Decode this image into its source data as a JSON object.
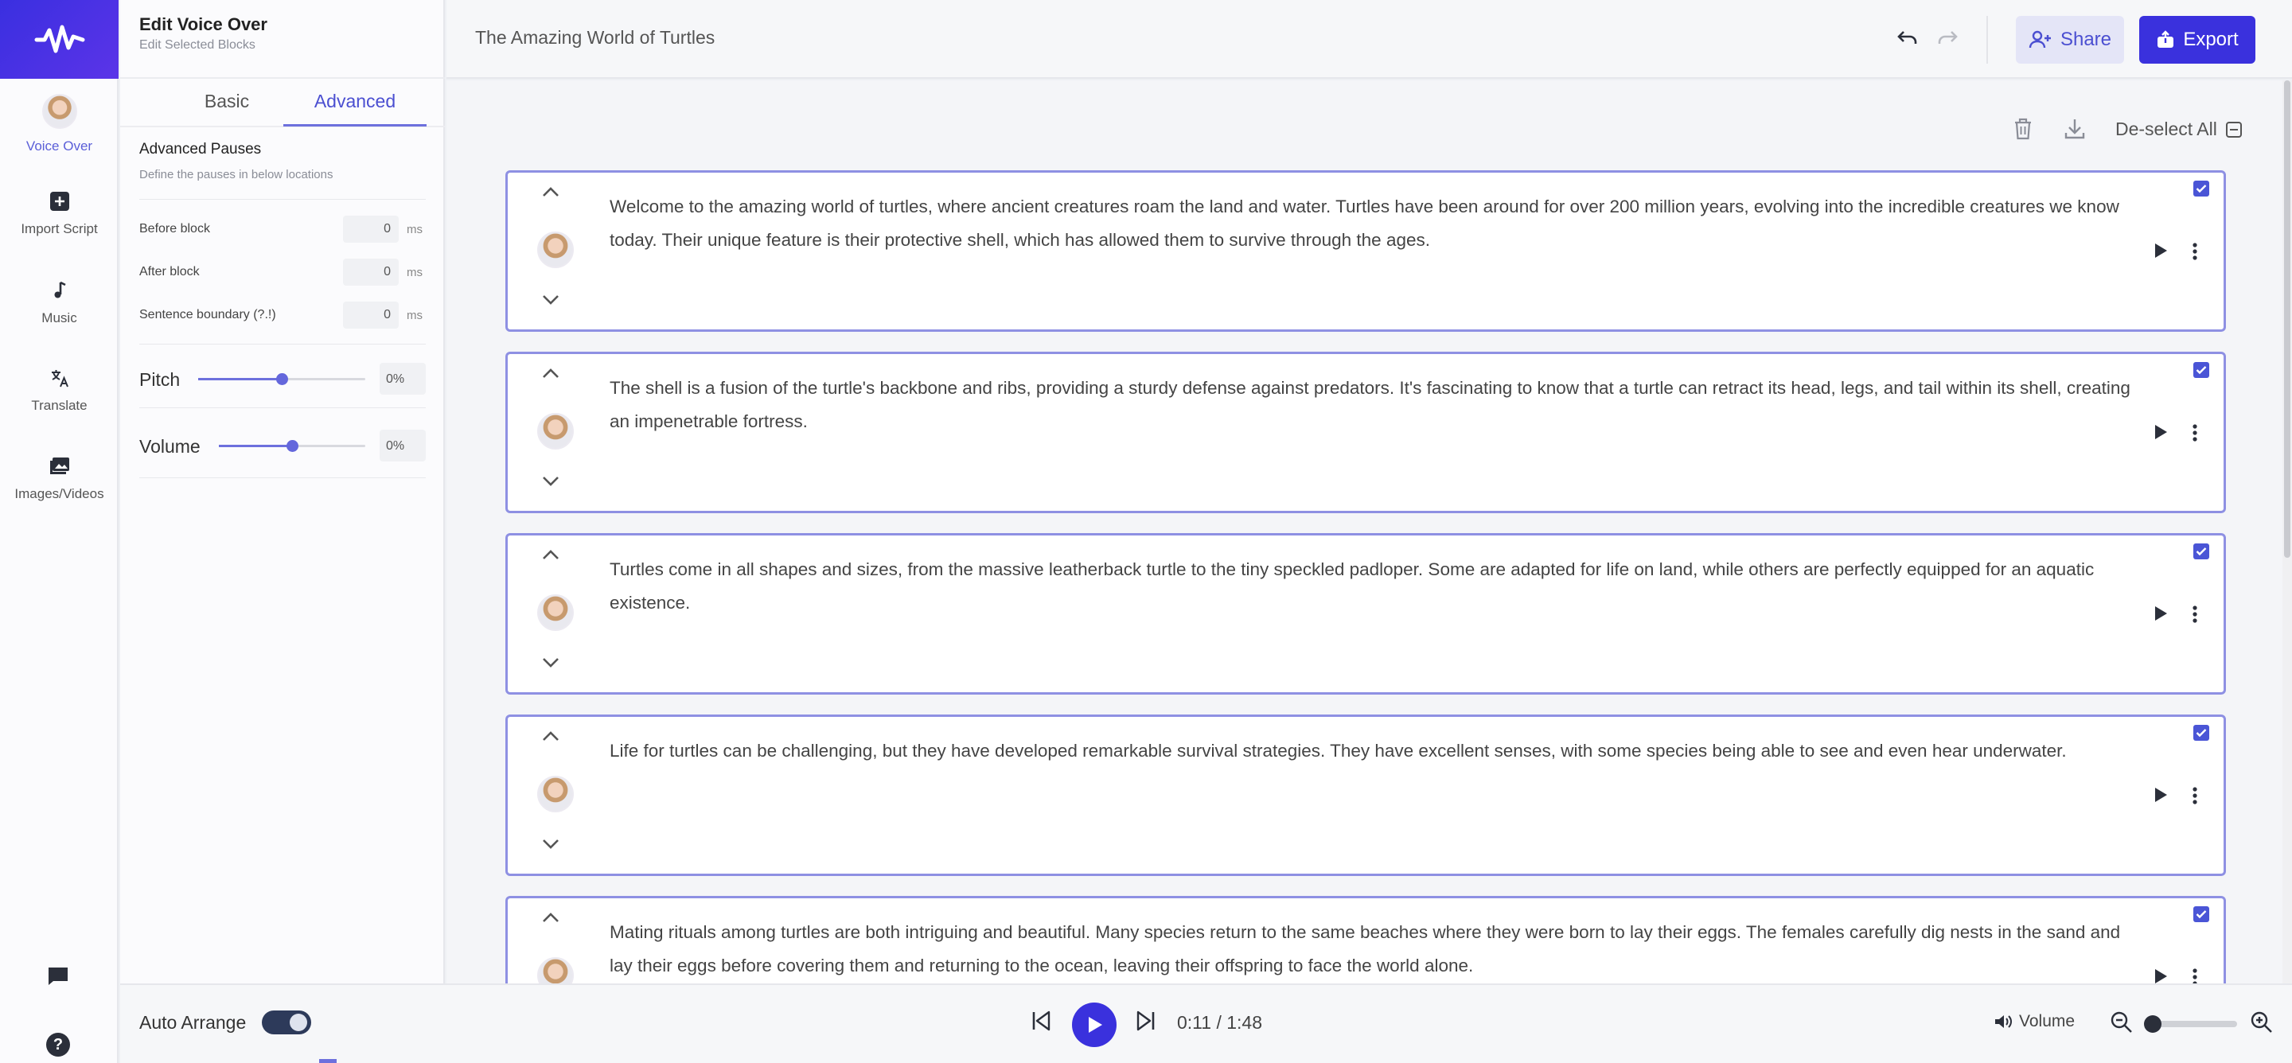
{
  "nav": {
    "items": [
      {
        "label": "Voice Over",
        "icon": "avatar-icon"
      },
      {
        "label": "Import Script",
        "icon": "plus-square-icon"
      },
      {
        "label": "Music",
        "icon": "music-note-icon"
      },
      {
        "label": "Translate",
        "icon": "translate-icon"
      },
      {
        "label": "Images/Videos",
        "icon": "image-icon"
      }
    ],
    "help_label": "?"
  },
  "panel": {
    "title": "Edit Voice Over",
    "subtitle": "Edit Selected Blocks",
    "tabs": [
      "Basic",
      "Advanced"
    ],
    "active_tab": "Advanced",
    "advanced_title": "Advanced Pauses",
    "advanced_subtitle": "Define the pauses in below locations",
    "pauses": [
      {
        "label": "Before block",
        "value": "0",
        "unit": "ms"
      },
      {
        "label": "After block",
        "value": "0",
        "unit": "ms"
      },
      {
        "label": "Sentence boundary (?.!)",
        "value": "0",
        "unit": "ms"
      }
    ],
    "pitch": {
      "label": "Pitch",
      "value": "0%",
      "level": 0.5
    },
    "volume": {
      "label": "Volume",
      "value": "0%",
      "level": 0.5
    }
  },
  "header": {
    "doc_title": "The Amazing World of Turtles",
    "share_label": "Share",
    "export_label": "Export"
  },
  "toolbar": {
    "deselect_label": "De-select All"
  },
  "blocks": [
    {
      "text": "Welcome to the amazing world of turtles, where ancient creatures roam the land and water. Turtles have been around for over 200 million years, evolving into the incredible creatures we know today. Their unique feature is their protective shell, which has allowed them to survive through the ages.",
      "checked": true
    },
    {
      "text": "The shell is a fusion of the turtle's backbone and ribs, providing a sturdy defense against predators. It's fascinating to know that a turtle can retract its head, legs, and tail within its shell, creating an impenetrable fortress.",
      "checked": true
    },
    {
      "text": "Turtles come in all shapes and sizes, from the massive leatherback turtle to the tiny speckled padloper. Some are adapted for life on land, while others are perfectly equipped for an aquatic existence.",
      "checked": true
    },
    {
      "text": "Life for turtles can be challenging, but they have developed remarkable survival strategies. They have excellent senses, with some species being able to see and even hear underwater.",
      "checked": true
    },
    {
      "text": "Mating rituals among turtles are both intriguing and beautiful. Many species return to the same beaches where they were born to lay their eggs. The females carefully dig nests in the sand and lay their eggs before covering them and returning to the ocean, leaving their offspring to face the world alone.",
      "checked": true
    }
  ],
  "player": {
    "auto_arrange_label": "Auto Arrange",
    "auto_arrange_on": true,
    "time": "0:11 / 1:48",
    "volume_label": "Volume"
  },
  "colors": {
    "accent": "#3a31dd",
    "accent_light": "#e4e5f7",
    "border": "#8e90e3"
  }
}
